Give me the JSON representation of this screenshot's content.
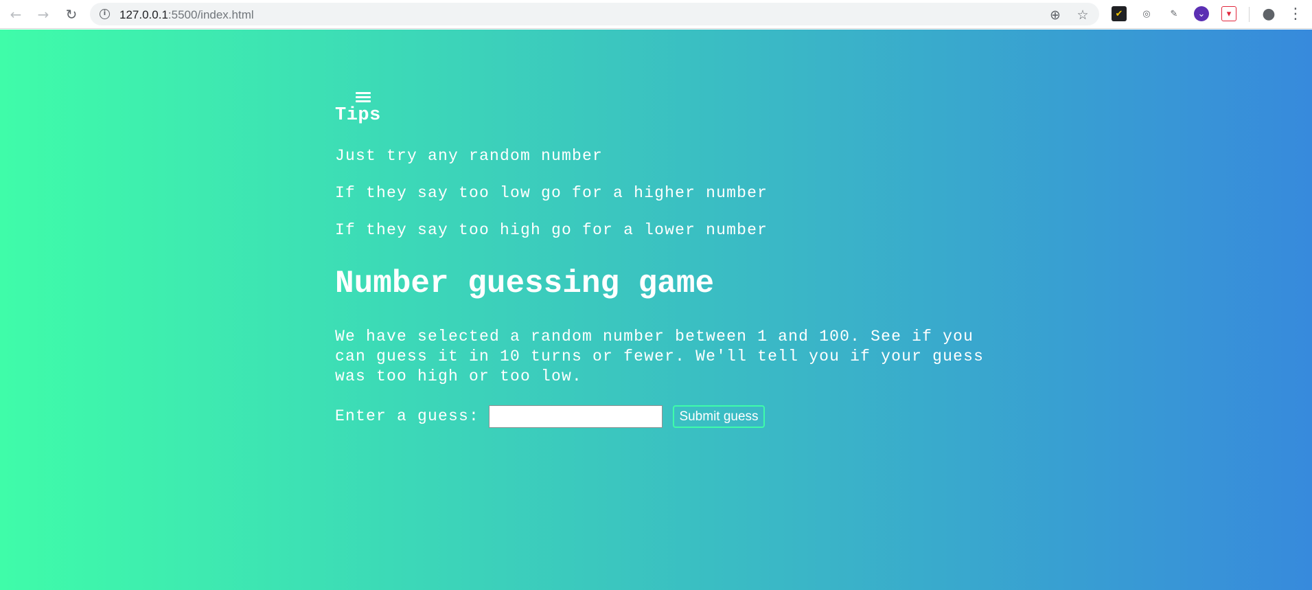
{
  "browser": {
    "url_host": "127.0.0.1",
    "url_rest": ":5500/index.html",
    "back_icon": "←",
    "forward_icon": "→",
    "reload_icon": "↻",
    "info_icon": "i",
    "zoom_icon": "⊕",
    "bookmark_icon": "☆",
    "extensions": [
      {
        "name": "checkmark-extension-icon",
        "glyph": "✔",
        "color": "#f2c400",
        "bg": "#202124"
      },
      {
        "name": "podcast-extension-icon",
        "glyph": "◎",
        "color": "#5f6368",
        "bg": "transparent"
      },
      {
        "name": "eyedropper-extension-icon",
        "glyph": "✎",
        "color": "#5f6368",
        "bg": "transparent"
      },
      {
        "name": "chevron-extension-icon",
        "glyph": "⌄",
        "color": "#ffffff",
        "bg": "#5b2fb3"
      },
      {
        "name": "pocket-extension-icon",
        "glyph": "▾",
        "color": "#e0263b",
        "bg": "#ffffff"
      }
    ],
    "profile_icon": "●",
    "menu_icon": "⋮"
  },
  "page": {
    "gradient_colors": [
      "#3ffca9",
      "#3bc8be",
      "#378adc"
    ],
    "tips": {
      "title": "Tips",
      "items": [
        "Just try any random number",
        "If they say too low go for a higher number",
        "If they say too high go for a lower number"
      ]
    },
    "game": {
      "title": "Number guessing game",
      "description": "We have selected a random number between 1 and 100. See if you can guess it in 10 turns or fewer. We'll tell you if your guess was too high or too low.",
      "guess_label": "Enter a guess:",
      "guess_value": "",
      "submit_label": "Submit guess",
      "submit_border_color": "#3ffca9"
    }
  }
}
